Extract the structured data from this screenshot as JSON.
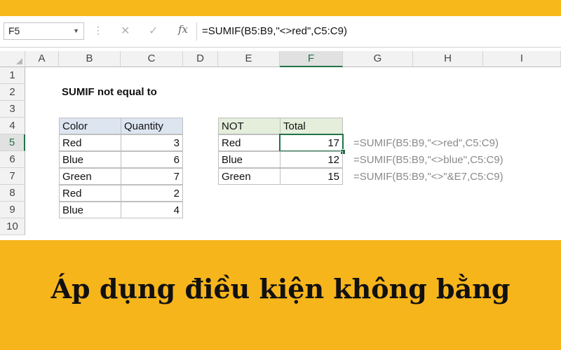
{
  "formula_bar": {
    "name_box": "F5",
    "cancel_glyph": "✕",
    "enter_glyph": "✓",
    "fx_label": "fx",
    "formula": "=SUMIF(B5:B9,\"<>red\",C5:C9)"
  },
  "columns": [
    "A",
    "B",
    "C",
    "D",
    "E",
    "F",
    "G",
    "H",
    "I"
  ],
  "rows": [
    "1",
    "2",
    "3",
    "4",
    "5",
    "6",
    "7",
    "8",
    "9",
    "10"
  ],
  "selected": {
    "column": "F",
    "row": "5"
  },
  "sheet": {
    "title": "SUMIF not equal to",
    "data_table": {
      "headers": [
        "Color",
        "Quantity"
      ],
      "rows": [
        [
          "Red",
          "3"
        ],
        [
          "Blue",
          "6"
        ],
        [
          "Green",
          "7"
        ],
        [
          "Red",
          "2"
        ],
        [
          "Blue",
          "4"
        ]
      ]
    },
    "summary_table": {
      "headers": [
        "NOT",
        "Total"
      ],
      "rows": [
        [
          "Red",
          "17"
        ],
        [
          "Blue",
          "12"
        ],
        [
          "Green",
          "15"
        ]
      ]
    },
    "formula_notes": [
      "=SUMIF(B5:B9,\"<>red\",C5:C9)",
      "=SUMIF(B5:B9,\"<>blue\",C5:C9)",
      "=SUMIF(B5:B9,\"<>\"&E7,C5:C9)"
    ]
  },
  "banner": {
    "text": "Áp dụng điều kiện không bằng"
  },
  "colors": {
    "brand_yellow": "#f6b81a",
    "excel_green": "#217346",
    "header_blue": "#dde5f1",
    "header_green": "#e4eedb"
  }
}
